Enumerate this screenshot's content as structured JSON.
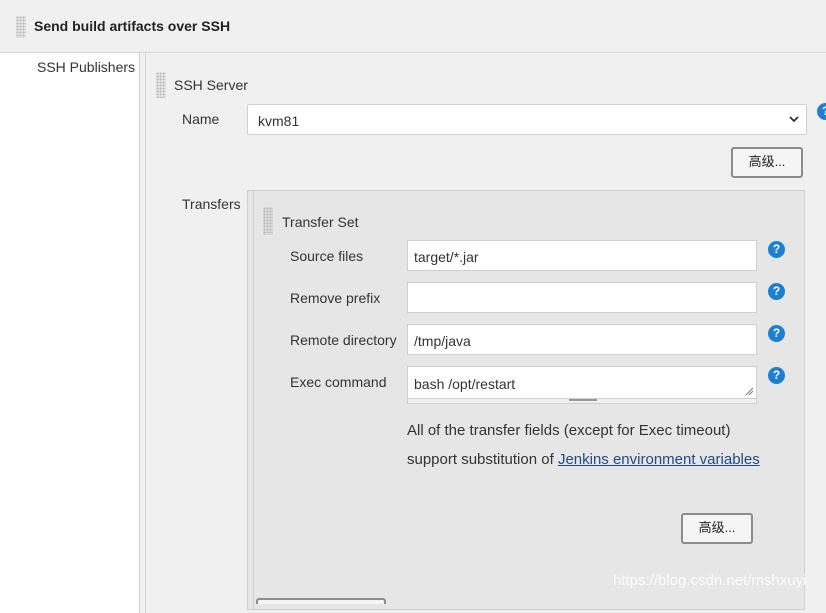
{
  "section": {
    "title": "Send build artifacts over SSH"
  },
  "publishers": {
    "label": "SSH Publishers"
  },
  "server": {
    "title": "SSH Server",
    "name_label": "Name",
    "name_value": "kvm81",
    "advanced_label": "高级...",
    "help_icon": "?"
  },
  "transfers": {
    "label": "Transfers",
    "set_title": "Transfer Set",
    "fields": [
      {
        "label": "Source files",
        "value": "target/*.jar",
        "help": "?"
      },
      {
        "label": "Remove prefix",
        "value": "",
        "help": "?"
      },
      {
        "label": "Remote directory",
        "value": "/tmp/java",
        "help": "?"
      },
      {
        "label": "Exec command",
        "value": "bash /opt/restart",
        "help": "?"
      }
    ],
    "description_prefix": "All of the transfer fields (except for Exec timeout) support substitution of ",
    "description_link": "Jenkins environment variables",
    "advanced_label": "高级..."
  },
  "watermark": "https://blog.csdn.net/mshxuyi",
  "colors": {
    "help_blue": "#1d7fd3",
    "link": "#204a87",
    "panel_bg": "#f0f0f0",
    "inner_panel_bg": "#e6e6e6"
  }
}
